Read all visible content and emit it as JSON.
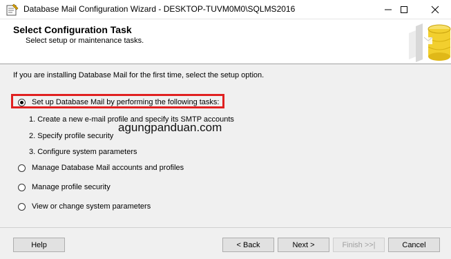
{
  "window": {
    "title": "Database Mail Configuration Wizard - DESKTOP-TUVM0M0\\SQLMS2016",
    "icon": "wizard-app-icon",
    "controls": {
      "minimize": "minimize-icon",
      "maximize": "maximize-icon",
      "close": "close-icon"
    }
  },
  "header": {
    "title": "Select Configuration Task",
    "subtitle": "Select setup or maintenance tasks.",
    "art": "database-cylinder-icon"
  },
  "content": {
    "intro": "If you are installing Database Mail for the first time, select the setup option.",
    "options": [
      {
        "label": "Set up Database Mail by performing the following tasks:",
        "selected": true
      },
      {
        "label": "Manage Database Mail accounts and profiles",
        "selected": false
      },
      {
        "label": "Manage profile security",
        "selected": false
      },
      {
        "label": "View or change system parameters",
        "selected": false
      }
    ],
    "tasks": [
      "1. Create a new e-mail profile and specify its SMTP accounts",
      "2. Specify profile security",
      "3. Configure system parameters"
    ],
    "watermark": "agungpanduan.com",
    "highlight_color": "#e02020"
  },
  "footer": {
    "help": "Help",
    "back": "< Back",
    "next": "Next >",
    "finish": "Finish >>|",
    "cancel": "Cancel"
  }
}
